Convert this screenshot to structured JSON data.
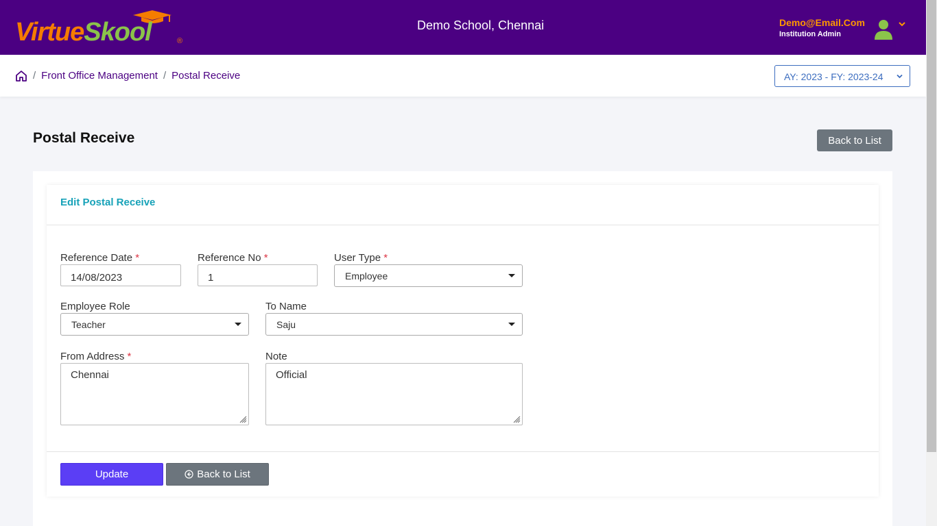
{
  "header": {
    "logo_part1": "Virtue",
    "logo_part2": "Skool",
    "logo_reg": "®",
    "school_name": "Demo School, Chennai",
    "user_email": "Demo@Email.Com",
    "user_role": "Institution Admin"
  },
  "breadcrumb": {
    "sep": "/",
    "items": [
      "Front Office Management",
      "Postal Receive"
    ]
  },
  "academic_year": "AY: 2023 - FY: 2023-24",
  "page": {
    "title": "Postal Receive",
    "back_button": "Back to List"
  },
  "form": {
    "title": "Edit Postal Receive",
    "reference_date": {
      "label": "Reference Date",
      "required_mark": "*",
      "value": "14/08/2023"
    },
    "reference_no": {
      "label": "Reference No",
      "required_mark": "*",
      "value": "1"
    },
    "user_type": {
      "label": "User Type",
      "required_mark": "*",
      "value": "Employee"
    },
    "employee_role": {
      "label": "Employee Role",
      "value": "Teacher"
    },
    "to_name": {
      "label": "To Name",
      "value": "Saju"
    },
    "from_address": {
      "label": "From Address",
      "required_mark": "*",
      "value": "Chennai"
    },
    "note": {
      "label": "Note",
      "value": "Official"
    },
    "update_button": "Update",
    "back_button": "Back to List"
  },
  "colors": {
    "header_bg": "#4b0082",
    "accent_orange": "#f57c00",
    "accent_green": "#8bc34a",
    "primary_button": "#5b3ef5",
    "secondary_button": "#6c757d",
    "card_title": "#17a2b8",
    "required": "#dc3545"
  },
  "icons": {
    "logo": "graduation-cap-icon",
    "avatar": "user-avatar-icon",
    "user_menu": "chevron-down-icon",
    "home": "home-icon",
    "back": "circle-arrow-left-icon"
  }
}
